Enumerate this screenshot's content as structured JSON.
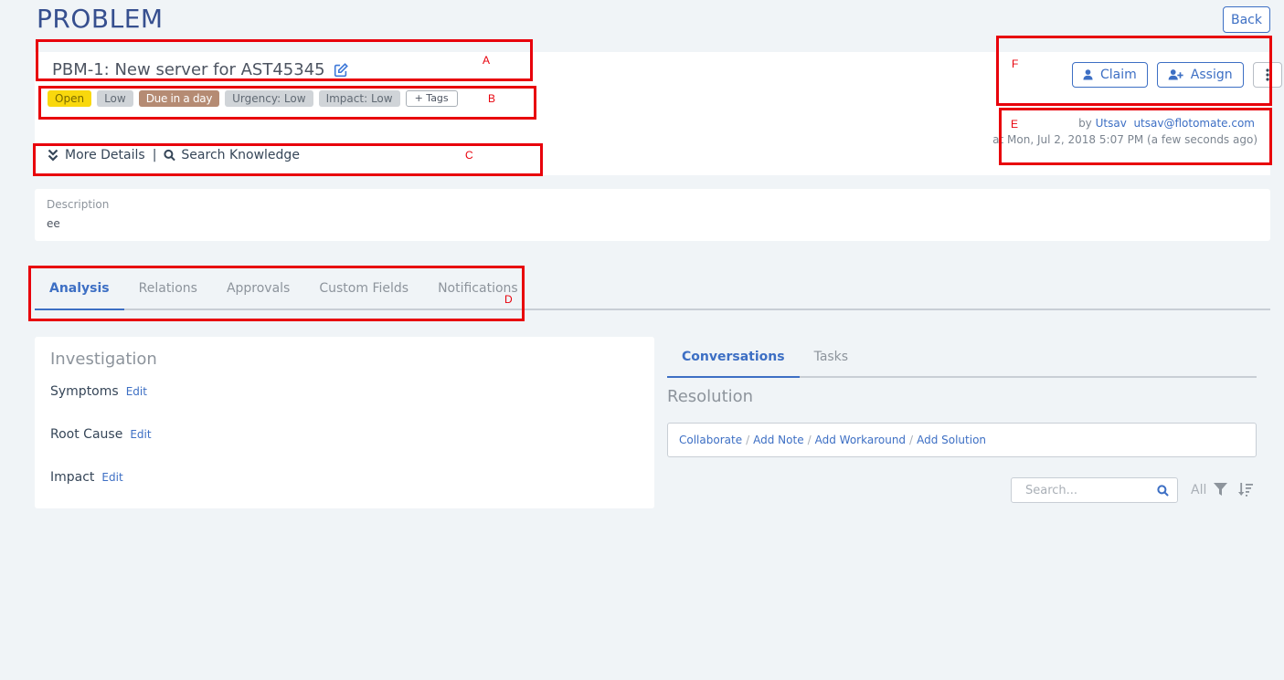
{
  "page": {
    "title": "PROBLEM",
    "back_label": "Back"
  },
  "header": {
    "title": "PBM-1: New server for AST45345",
    "tags": [
      "Open",
      "Low",
      "Due in a day",
      "Urgency: Low",
      "Impact: Low"
    ],
    "add_tags_label": "+ Tags",
    "more_details_label": "More Details",
    "separator": "|",
    "search_knowledge_label": "Search Knowledge"
  },
  "actions": {
    "claim_label": "Claim",
    "assign_label": "Assign"
  },
  "meta": {
    "by_prefix": "by",
    "user": "Utsav",
    "email": "utsav@flotomate.com",
    "timestamp": "at Mon, Jul 2, 2018 5:07 PM (a few seconds ago)"
  },
  "description": {
    "label": "Description",
    "value": "ee"
  },
  "tabs": [
    "Analysis",
    "Relations",
    "Approvals",
    "Custom Fields",
    "Notifications"
  ],
  "investigation": {
    "title": "Investigation",
    "rows": [
      {
        "label": "Symptoms",
        "edit": "Edit"
      },
      {
        "label": "Root Cause",
        "edit": "Edit"
      },
      {
        "label": "Impact",
        "edit": "Edit"
      }
    ]
  },
  "right_tabs": [
    "Conversations",
    "Tasks"
  ],
  "resolution": {
    "title": "Resolution",
    "links": [
      "Collaborate",
      "Add Note",
      "Add Workaround",
      "Add Solution"
    ],
    "separator": "/"
  },
  "search": {
    "placeholder": "Search...",
    "filter_label": "All"
  },
  "annotations": [
    "A",
    "B",
    "C",
    "D",
    "E",
    "F"
  ],
  "colors": {
    "accent": "#3d6fc4",
    "highlight": "#e8000b",
    "tag_open": "#f9d80d",
    "tag_due": "#b58b73"
  }
}
